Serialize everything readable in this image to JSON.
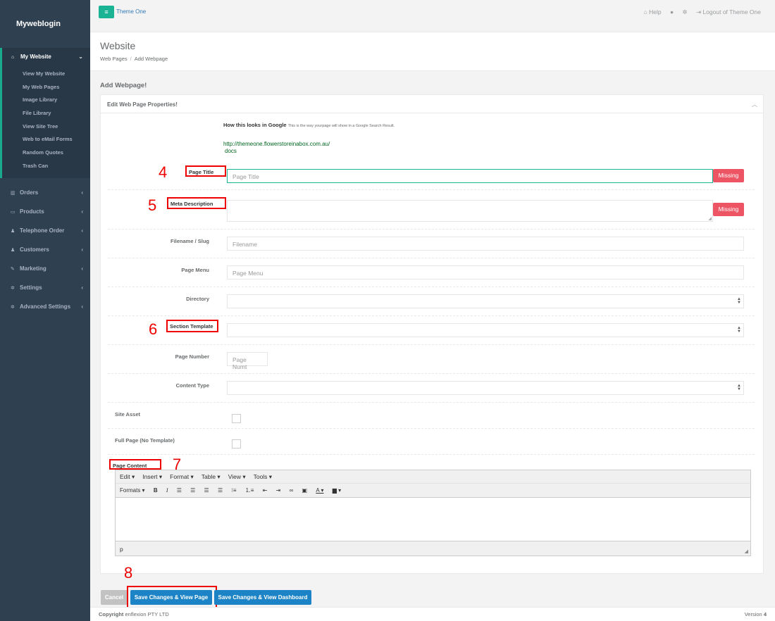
{
  "sidebar": {
    "brand": "Myweblogin",
    "active": {
      "label": "My Website",
      "icon": "home-icon"
    },
    "sub_items": [
      "View My Website",
      "My Web Pages",
      "Image Library",
      "File Library",
      "View Site Tree",
      "Web to eMail Forms",
      "Random Quotes",
      "Trash Can"
    ],
    "items": [
      {
        "label": "Orders",
        "icon": "bar-chart-icon"
      },
      {
        "label": "Products",
        "icon": "desktop-icon"
      },
      {
        "label": "Telephone Order",
        "icon": "users-icon"
      },
      {
        "label": "Customers",
        "icon": "users-icon"
      },
      {
        "label": "Marketing",
        "icon": "wrench-icon"
      },
      {
        "label": "Settings",
        "icon": "gear-icon"
      },
      {
        "label": "Advanced Settings",
        "icon": "gears-icon"
      }
    ]
  },
  "topbar": {
    "menu_icon": "≡",
    "site": "Theme One",
    "help": "Help",
    "logout": "Logout of Theme One"
  },
  "heading": {
    "title": "Website",
    "crumb1": "Web Pages",
    "crumb_sep": "/",
    "crumb2": "Add Webpage"
  },
  "section_title": "Add Webpage!",
  "panel": {
    "title": "Edit Web Page Properties!",
    "google_label": "How this looks in Google",
    "google_desc": "This is the way yourpage will show in a Google Search Result.",
    "google_url": "http://themeone.flowerstoreinabox.com.au/",
    "google_path": "docs"
  },
  "fields": {
    "page_title": {
      "label": "Page Title",
      "placeholder": "Page Title",
      "badge": "Missing"
    },
    "meta_description": {
      "label": "Meta Description",
      "badge": "Missing"
    },
    "filename": {
      "label": "Filename / Slug",
      "placeholder": "Filename"
    },
    "page_menu": {
      "label": "Page Menu",
      "placeholder": "Page Menu"
    },
    "directory": {
      "label": "Directory"
    },
    "section_template": {
      "label": "Section Template"
    },
    "page_number": {
      "label": "Page Number",
      "placeholder": "Page Numt"
    },
    "content_type": {
      "label": "Content Type"
    },
    "site_asset": {
      "label": "Site Asset"
    },
    "full_page": {
      "label": "Full Page (No Template)"
    },
    "page_content": {
      "label": "Page Content"
    }
  },
  "annotations": {
    "n4": "4",
    "n5": "5",
    "n6": "6",
    "n7": "7",
    "n8": "8"
  },
  "editor": {
    "menus": [
      "Edit ▾",
      "Insert ▾",
      "Format ▾",
      "Table ▾",
      "View ▾",
      "Tools ▾"
    ],
    "formats": "Formats ▾",
    "status": "p"
  },
  "buttons": {
    "cancel": "Cancel",
    "save_view": "Save Changes & View Page",
    "save_dash": "Save Changes & View Dashboard"
  },
  "footer": {
    "copyright_label": "Copyright",
    "company": "enflexion PTY LTD",
    "version_label": "Version",
    "version": "4"
  },
  "colors": {
    "sidebar": "#2f4050",
    "accent": "#1ab394",
    "danger": "#ed5565",
    "primary": "#1c84c6",
    "annotation": "#ee0000"
  }
}
